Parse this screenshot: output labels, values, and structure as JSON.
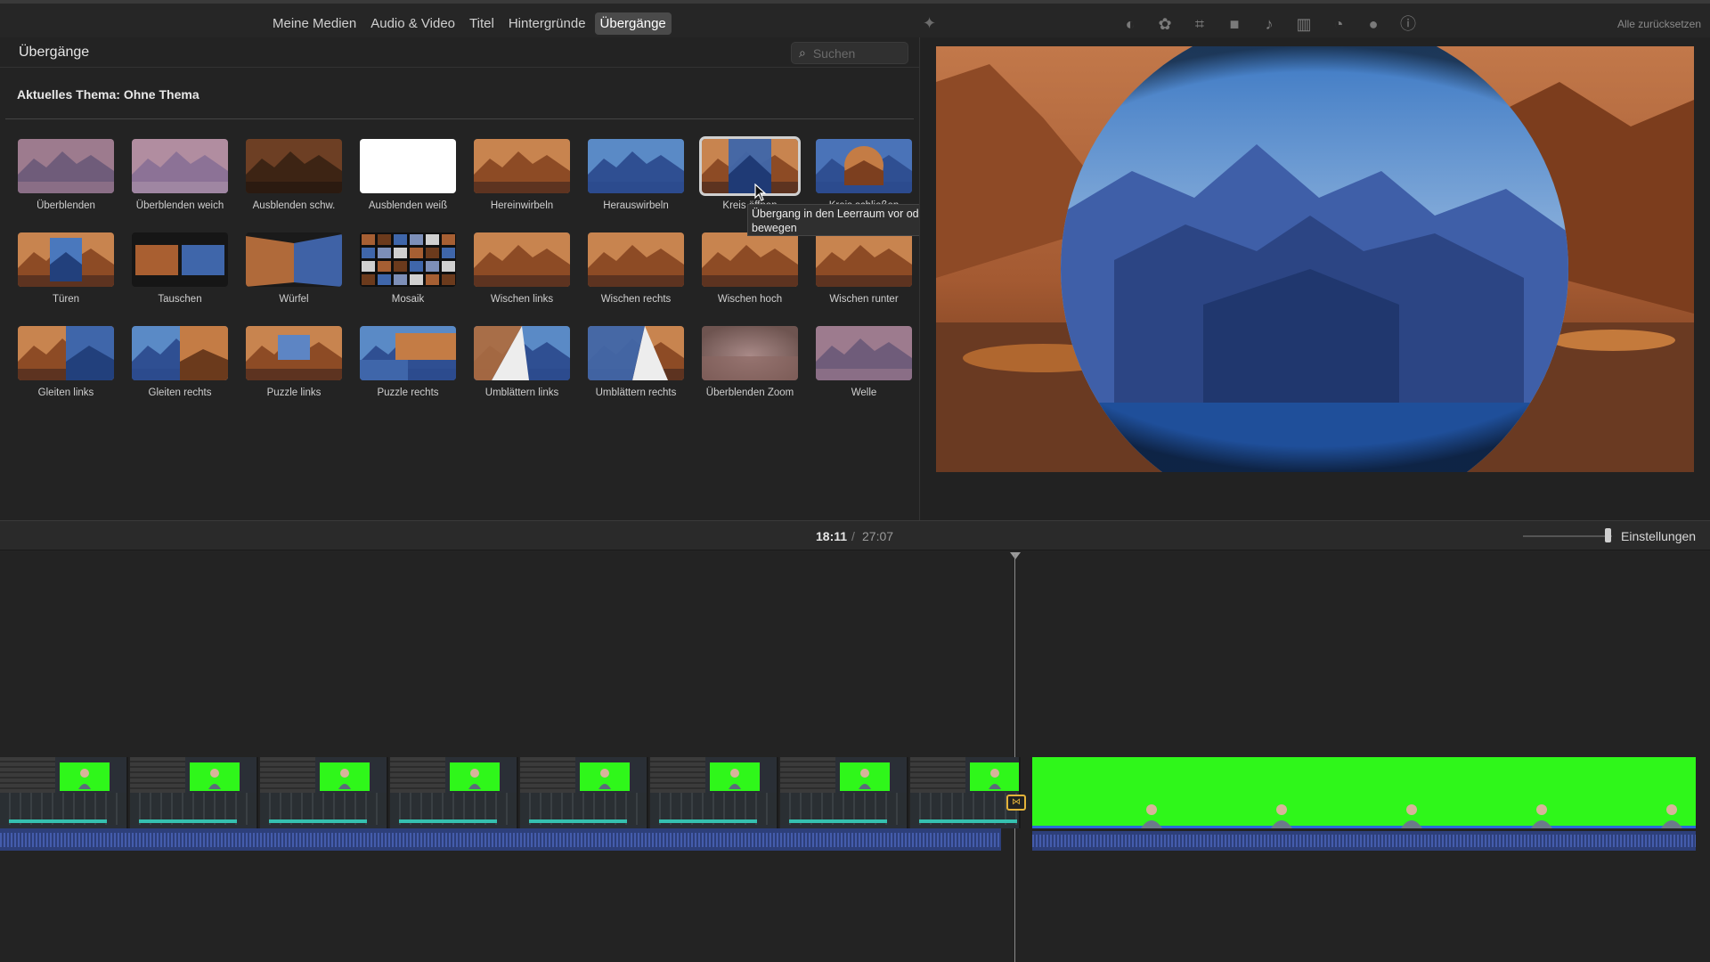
{
  "tabs": [
    {
      "label": "Meine Medien",
      "active": false
    },
    {
      "label": "Audio & Video",
      "active": false
    },
    {
      "label": "Titel",
      "active": false
    },
    {
      "label": "Hintergründe",
      "active": false
    },
    {
      "label": "Übergänge",
      "active": true
    }
  ],
  "toolbar": {
    "reset_label": "Alle zurücksetzen",
    "tools": [
      "color-balance-icon",
      "color-correction-icon",
      "crop-icon",
      "stabilization-icon",
      "volume-icon",
      "equalizer-icon",
      "speed-icon",
      "noise-reduction-icon",
      "info-icon"
    ]
  },
  "browser": {
    "title": "Übergänge",
    "search_placeholder": "Suchen",
    "theme_label": "Aktuelles Thema: Ohne Thema",
    "items": [
      {
        "label": "Überblenden",
        "style": "fade"
      },
      {
        "label": "Überblenden weich",
        "style": "soft"
      },
      {
        "label": "Ausblenden schw.",
        "style": "dark"
      },
      {
        "label": "Ausblenden weiß",
        "style": "white"
      },
      {
        "label": "Hereinwirbeln",
        "style": "orange"
      },
      {
        "label": "Herauswirbeln",
        "style": "blue"
      },
      {
        "label": "Kreis öffnen",
        "style": "split",
        "selected": true
      },
      {
        "label": "Kreis schließen",
        "style": "circle"
      },
      {
        "label": "Türen",
        "style": "doors"
      },
      {
        "label": "Tauschen",
        "style": "swap"
      },
      {
        "label": "Würfel",
        "style": "cube"
      },
      {
        "label": "Mosaik",
        "style": "mosaic"
      },
      {
        "label": "Wischen links",
        "style": "orange"
      },
      {
        "label": "Wischen rechts",
        "style": "orange"
      },
      {
        "label": "Wischen hoch",
        "style": "orange"
      },
      {
        "label": "Wischen runter",
        "style": "orange"
      },
      {
        "label": "Gleiten links",
        "style": "half"
      },
      {
        "label": "Gleiten rechts",
        "style": "half2"
      },
      {
        "label": "Puzzle links",
        "style": "puzzle"
      },
      {
        "label": "Puzzle rechts",
        "style": "puzzle2"
      },
      {
        "label": "Umblättern links",
        "style": "page"
      },
      {
        "label": "Umblättern rechts",
        "style": "page2"
      },
      {
        "label": "Überblenden Zoom",
        "style": "zoom"
      },
      {
        "label": "Welle",
        "style": "fade"
      }
    ]
  },
  "tooltip": {
    "text": "Übergang in den Leerraum vor oder nach einem Clip bewegen"
  },
  "timebar": {
    "current": "18:11",
    "separator": "/",
    "total": "27:07",
    "settings_label": "Einstellungen"
  },
  "colors": {
    "green_screen": "#2ff71a",
    "accent": "#e4b33a",
    "audio": "#2d3f7a"
  }
}
